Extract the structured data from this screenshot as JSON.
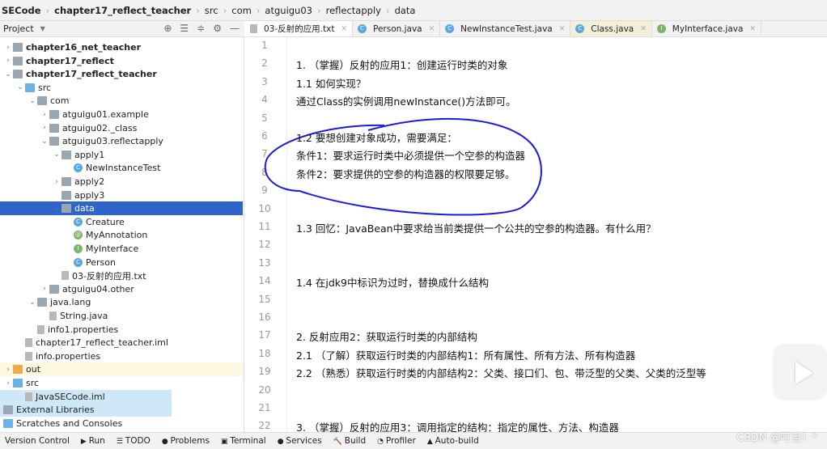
{
  "breadcrumb": [
    "SECode",
    "chapter17_reflect_teacher",
    "src",
    "com",
    "atguigu03",
    "reflectapply",
    "data"
  ],
  "project_panel": {
    "title": "Project",
    "tree": [
      {
        "label": "chapter16_net_teacher",
        "bold": true,
        "arrow": ">",
        "icon": "module",
        "indent": 0
      },
      {
        "label": "chapter17_reflect",
        "bold": true,
        "arrow": ">",
        "icon": "module",
        "indent": 0
      },
      {
        "label": "chapter17_reflect_teacher",
        "bold": true,
        "arrow": "v",
        "icon": "module",
        "indent": 0
      },
      {
        "label": "src",
        "arrow": "v",
        "icon": "src-folder",
        "indent": 1
      },
      {
        "label": "com",
        "arrow": "v",
        "icon": "folder",
        "indent": 2
      },
      {
        "label": "atguigu01.example",
        "arrow": ">",
        "icon": "folder",
        "indent": 3
      },
      {
        "label": "atguigu02._class",
        "arrow": ">",
        "icon": "folder",
        "indent": 3
      },
      {
        "label": "atguigu03.reflectapply",
        "arrow": "v",
        "icon": "folder",
        "indent": 3
      },
      {
        "label": "apply1",
        "arrow": "v",
        "icon": "folder",
        "indent": 4
      },
      {
        "label": "NewInstanceTest",
        "icon": "class",
        "indent": 5
      },
      {
        "label": "apply2",
        "arrow": ">",
        "icon": "folder",
        "indent": 4
      },
      {
        "label": "apply3",
        "icon": "folder",
        "indent": 4
      },
      {
        "label": "data",
        "arrow": "v",
        "icon": "folder",
        "indent": 4,
        "selected": true
      },
      {
        "label": "Creature",
        "icon": "class",
        "indent": 5
      },
      {
        "label": "MyAnnotation",
        "icon": "annotation",
        "indent": 5
      },
      {
        "label": "MyInterface",
        "icon": "interface",
        "indent": 5
      },
      {
        "label": "Person",
        "icon": "class",
        "indent": 5
      },
      {
        "label": "03-反射的应用.txt",
        "icon": "file",
        "indent": 4
      },
      {
        "label": "atguigu04.other",
        "arrow": ">",
        "icon": "folder",
        "indent": 3
      },
      {
        "label": "java.lang",
        "arrow": "v",
        "icon": "folder",
        "indent": 2
      },
      {
        "label": "String.java",
        "icon": "file",
        "indent": 3
      },
      {
        "label": "info1.properties",
        "icon": "file",
        "indent": 2
      },
      {
        "label": "chapter17_reflect_teacher.iml",
        "icon": "file",
        "indent": 1
      },
      {
        "label": "info.properties",
        "icon": "file",
        "indent": 1
      },
      {
        "label": "out",
        "arrow": ">",
        "icon": "out-folder",
        "indent": 0,
        "out": true
      },
      {
        "label": "src",
        "arrow": ">",
        "icon": "src-folder",
        "indent": 0
      },
      {
        "label": "JavaSECode.iml",
        "icon": "file",
        "indent": 1,
        "blue": true
      },
      {
        "label": "External Libraries",
        "icon": "library",
        "indent": -1,
        "blue": true
      },
      {
        "label": "Scratches and Consoles",
        "icon": "scratch",
        "indent": -1
      }
    ]
  },
  "tabs": [
    {
      "label": "03-反射的应用.txt",
      "icon": "text",
      "active": true
    },
    {
      "label": "Person.java",
      "icon": "class"
    },
    {
      "label": "NewInstanceTest.java",
      "icon": "class"
    },
    {
      "label": "Class.java",
      "icon": "class"
    },
    {
      "label": "MyInterface.java",
      "icon": "interface"
    }
  ],
  "editor": {
    "lines": [
      "",
      "1. （掌握）反射的应用1：创建运行时类的对象",
      "1.1 如何实现？",
      "通过Class的实例调用newInstance()方法即可。",
      "",
      "1.2 要想创建对象成功，需要满足：",
      "条件1：要求运行时类中必须提供一个空参的构造器",
      "条件2：要求提供的空参的构造器的权限要足够。",
      "",
      "",
      "1.3 回忆：JavaBean中要求给当前类提供一个公共的空参的构造器。有什么用？",
      "",
      "",
      "1.4 在jdk9中标识为过时，替换成什么结构",
      "",
      "",
      "2. 反射应用2：获取运行时类的内部结构",
      "2.1 （了解）获取运行时类的内部结构1：所有属性、所有方法、所有构造器",
      "2.2 （熟悉）获取运行时类的内部结构2：父类、接口们、包、带泛型的父类、父类的泛型等",
      "",
      "",
      "3. （掌握）反射的应用3：调用指定的结构：指定的属性、方法、构造器"
    ]
  },
  "status_bar": [
    "Version Control",
    "Run",
    "TODO",
    "Problems",
    "Terminal",
    "Services",
    "Build",
    "Profiler",
    "Auto-build"
  ],
  "watermark": "CSDN @叮当！*",
  "annotation_color": "#1a1ae6"
}
